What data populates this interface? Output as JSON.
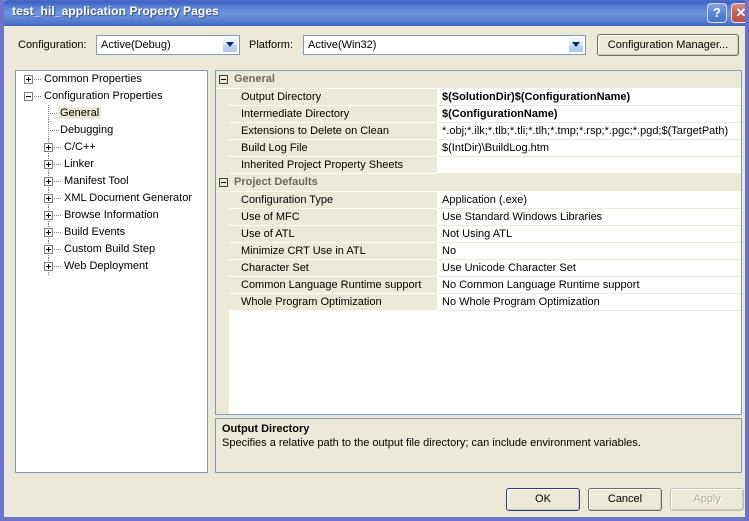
{
  "window": {
    "title": "test_hil_application Property Pages",
    "help_button": "?",
    "close_button": "✕",
    "frame_color": "#6f72c9",
    "titlebar_color": "#3f62c0"
  },
  "config_bar": {
    "configuration_label": "Configuration:",
    "configuration_value": "Active(Debug)",
    "platform_label": "Platform:",
    "platform_value": "Active(Win32)",
    "configuration_manager_button": "Configuration Manager..."
  },
  "tree": {
    "items": [
      {
        "label": "Common Properties",
        "depth": 0,
        "toggle": "plus",
        "selected": false
      },
      {
        "label": "Configuration Properties",
        "depth": 0,
        "toggle": "minus",
        "selected": false
      },
      {
        "label": "General",
        "depth": 1,
        "toggle": "none",
        "selected": true
      },
      {
        "label": "Debugging",
        "depth": 1,
        "toggle": "none",
        "selected": false
      },
      {
        "label": "C/C++",
        "depth": 1,
        "toggle": "plus",
        "selected": false
      },
      {
        "label": "Linker",
        "depth": 1,
        "toggle": "plus",
        "selected": false
      },
      {
        "label": "Manifest Tool",
        "depth": 1,
        "toggle": "plus",
        "selected": false
      },
      {
        "label": "XML Document Generator",
        "depth": 1,
        "toggle": "plus",
        "selected": false
      },
      {
        "label": "Browse Information",
        "depth": 1,
        "toggle": "plus",
        "selected": false
      },
      {
        "label": "Build Events",
        "depth": 1,
        "toggle": "plus",
        "selected": false
      },
      {
        "label": "Custom Build Step",
        "depth": 1,
        "toggle": "plus",
        "selected": false
      },
      {
        "label": "Web Deployment",
        "depth": 1,
        "toggle": "plus",
        "selected": false
      }
    ]
  },
  "grid": {
    "sections": [
      {
        "title": "General",
        "collapsed": false,
        "rows": [
          {
            "name": "Output Directory",
            "value": "$(SolutionDir)$(ConfigurationName)",
            "bold": true
          },
          {
            "name": "Intermediate Directory",
            "value": "$(ConfigurationName)",
            "bold": true
          },
          {
            "name": "Extensions to Delete on Clean",
            "value": "*.obj;*.ilk;*.tlb;*.tli;*.tlh;*.tmp;*.rsp;*.pgc;*.pgd;$(TargetPath)",
            "bold": false
          },
          {
            "name": "Build Log File",
            "value": "$(IntDir)\\BuildLog.htm",
            "bold": false
          },
          {
            "name": "Inherited Project Property Sheets",
            "value": "",
            "bold": false
          }
        ]
      },
      {
        "title": "Project Defaults",
        "collapsed": false,
        "rows": [
          {
            "name": "Configuration Type",
            "value": "Application (.exe)",
            "bold": false
          },
          {
            "name": "Use of MFC",
            "value": "Use Standard Windows Libraries",
            "bold": false
          },
          {
            "name": "Use of ATL",
            "value": "Not Using ATL",
            "bold": false
          },
          {
            "name": "Minimize CRT Use in ATL",
            "value": "No",
            "bold": false
          },
          {
            "name": "Character Set",
            "value": "Use Unicode Character Set",
            "bold": false
          },
          {
            "name": "Common Language Runtime support",
            "value": "No Common Language Runtime support",
            "bold": false
          },
          {
            "name": "Whole Program Optimization",
            "value": "No Whole Program Optimization",
            "bold": false
          }
        ]
      }
    ]
  },
  "description": {
    "title": "Output Directory",
    "text": "Specifies a relative path to the output file directory; can include environment variables."
  },
  "buttons": {
    "ok": "OK",
    "cancel": "Cancel",
    "apply": "Apply",
    "apply_disabled": true
  }
}
